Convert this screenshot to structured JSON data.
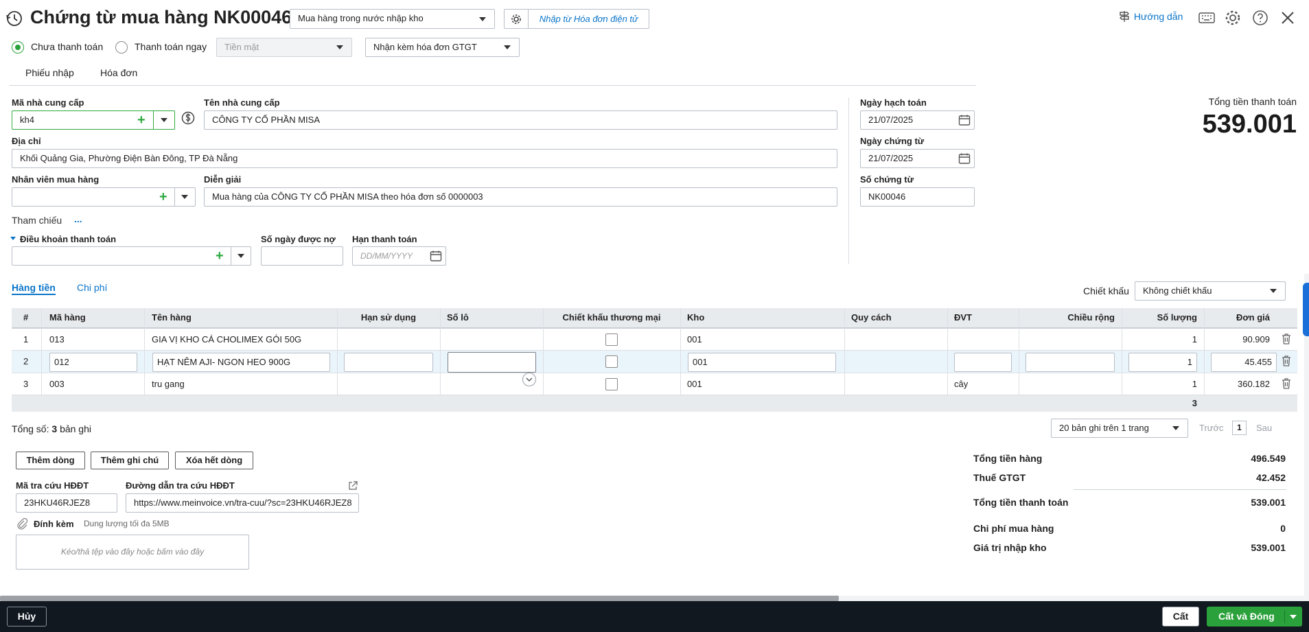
{
  "header": {
    "title": "Chứng từ mua hàng NK00046",
    "purchase_type": "Mua hàng trong nước nhập kho",
    "import_einvoice": "Nhập từ Hóa đơn điện tử",
    "guide": "Hướng dẫn"
  },
  "payment": {
    "unpaid": "Chưa thanh toán",
    "paid_now": "Thanh toán ngay",
    "method": "Tiền mặt",
    "invoice_option": "Nhận kèm hóa đơn GTGT"
  },
  "doc_tabs": [
    "Phiếu nhập",
    "Hóa đơn"
  ],
  "form": {
    "supplier_code_label": "Mã nhà cung cấp",
    "supplier_code": "kh4",
    "supplier_name_label": "Tên nhà cung cấp",
    "supplier_name": "CÔNG TY CỔ PHẦN MISA",
    "address_label": "Địa chỉ",
    "address": "Khối Quảng Gia, Phường Điện Bàn Đông, TP Đà Nẵng",
    "employee_label": "Nhân viên mua hàng",
    "employee": "",
    "description_label": "Diễn giải",
    "description": "Mua hàng của CÔNG TY CỔ PHẦN MISA theo hóa đơn số 0000003",
    "reference_label": "Tham chiếu",
    "reference_more": "...",
    "payment_terms_label": "Điều khoản thanh toán",
    "debt_days_label": "Số ngày được nợ",
    "due_date_label": "Hạn thanh toán",
    "due_date_placeholder": "DD/MM/YYYY",
    "posting_date_label": "Ngày hạch toán",
    "posting_date": "21/07/2025",
    "doc_date_label": "Ngày chứng từ",
    "doc_date": "21/07/2025",
    "doc_no_label": "Số chứng từ",
    "doc_no": "NK00046"
  },
  "total_box": {
    "label": "Tổng tiền thanh toán",
    "value": "539.001"
  },
  "detail_tabs": [
    "Hàng tiền",
    "Chi phí"
  ],
  "discount": {
    "label": "Chiết khấu",
    "value": "Không chiết khấu"
  },
  "table": {
    "columns": [
      "#",
      "Mã hàng",
      "Tên hàng",
      "Hạn sử dụng",
      "Số lô",
      "Chiết khấu thương mại",
      "Kho",
      "Quy cách",
      "ĐVT",
      "Chiều rộng",
      "Số lượng",
      "Đơn giá"
    ],
    "rows": [
      {
        "no": "1",
        "code": "013",
        "name": "GIA VỊ KHO CÁ CHOLIMEX GÓI 50G",
        "expiry": "",
        "lot": "",
        "warehouse": "001",
        "spec": "",
        "unit": "",
        "width": "",
        "qty": "1",
        "price": "90.909"
      },
      {
        "no": "2",
        "code": "012",
        "name": "HẠT NÊM AJI- NGON HEO 900G",
        "expiry": "",
        "lot": "",
        "warehouse": "001",
        "spec": "",
        "unit": "",
        "width": "",
        "qty": "1",
        "price": "45.455"
      },
      {
        "no": "3",
        "code": "003",
        "name": "tru gang",
        "expiry": "",
        "lot": "",
        "warehouse": "001",
        "spec": "",
        "unit": "cây",
        "width": "",
        "qty": "1",
        "price": "360.182"
      }
    ],
    "total_qty": "3"
  },
  "records": {
    "prefix": "Tổng số:",
    "count": "3",
    "suffix": "bản ghi",
    "page_size": "20 bản ghi trên 1 trang",
    "prev": "Trước",
    "page": "1",
    "next": "Sau"
  },
  "actions": {
    "add_row": "Thêm dòng",
    "add_note": "Thêm ghi chú",
    "delete_rows": "Xóa hết dòng"
  },
  "einvoice": {
    "lookup_code_label": "Mã tra cứu HĐĐT",
    "lookup_code": "23HKU46RJEZ8",
    "lookup_url_label": "Đường dẫn tra cứu HĐĐT",
    "lookup_url": "https://www.meinvoice.vn/tra-cuu/?sc=23HKU46RJEZ8"
  },
  "attachment": {
    "label": "Đính kèm",
    "hint": "Dung lượng tối đa 5MB",
    "drop": "Kéo/thả tệp vào đây hoặc bấm vào đây"
  },
  "summary": [
    {
      "label": "Tổng tiền hàng",
      "value": "496.549"
    },
    {
      "label": "Thuế GTGT",
      "value": "42.452"
    },
    {
      "label": "Tổng tiền thanh toán",
      "value": "539.001"
    },
    {
      "label": "Chi phí mua hàng",
      "value": "0"
    },
    {
      "label": "Giá trị nhập kho",
      "value": "539.001"
    }
  ],
  "footer": {
    "cancel": "Hủy",
    "save": "Cất",
    "save_close": "Cất và Đóng"
  },
  "colors": {
    "accent_green": "#2aa13a",
    "link_blue": "#0a74c9",
    "footer_bg": "#111820",
    "row_selected": "#eaf4fb"
  }
}
